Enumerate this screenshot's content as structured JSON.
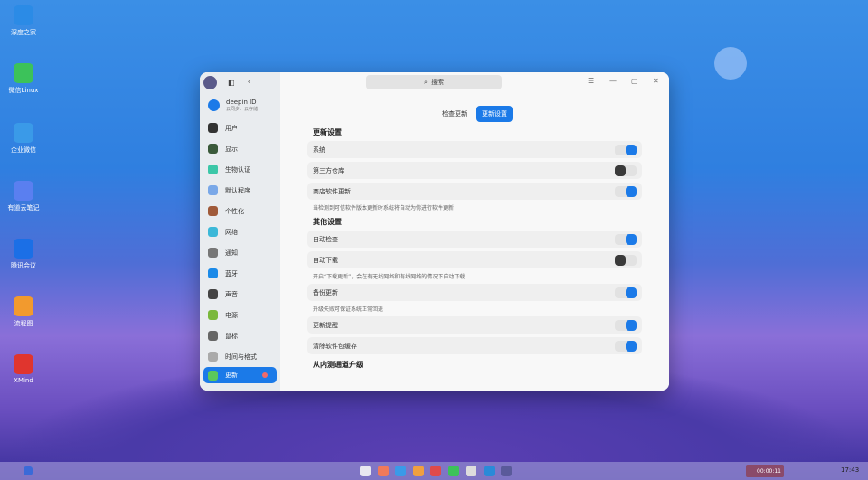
{
  "desktop": {
    "icons": [
      {
        "label": "深度之家",
        "color": "#2b8be6"
      },
      {
        "label": "微信Linux",
        "color": "#3cc25a"
      },
      {
        "label": "企业微信",
        "color": "#3a9ae8"
      },
      {
        "label": "有道云笔记",
        "color": "#5a7ff0"
      },
      {
        "label": "腾讯会议",
        "color": "#1b6fe6"
      },
      {
        "label": "流程图",
        "color": "#f29a2e"
      },
      {
        "label": "XMind",
        "color": "#e0352e"
      }
    ]
  },
  "window": {
    "search_placeholder": "搜索",
    "window_controls": [
      "menu-icon",
      "minimize-icon",
      "maximize-icon",
      "close-icon"
    ]
  },
  "sidebar": {
    "account": {
      "title": "deepin ID",
      "subtitle": "云同步、云存储"
    },
    "items": [
      {
        "label": "用户",
        "color": "#333"
      },
      {
        "label": "显示",
        "color": "#3b5a3b"
      },
      {
        "label": "生物认证",
        "color": "#3cc7a8"
      },
      {
        "label": "默认程序",
        "color": "#7aa8e8"
      },
      {
        "label": "个性化",
        "color": "#a05a3a"
      },
      {
        "label": "网络",
        "color": "#3cb8d8"
      },
      {
        "label": "通知",
        "color": "#777"
      },
      {
        "label": "蓝牙",
        "color": "#1b8ae8"
      },
      {
        "label": "声音",
        "color": "#444"
      },
      {
        "label": "电源",
        "color": "#7ab83c"
      },
      {
        "label": "鼠标",
        "color": "#666"
      },
      {
        "label": "时间与格式",
        "color": "#aaa"
      },
      {
        "label": "更新",
        "color": "#5bc85b",
        "active": true
      }
    ]
  },
  "tabs": [
    {
      "label": "检查更新",
      "active": false
    },
    {
      "label": "更新设置",
      "active": true
    }
  ],
  "sections": [
    {
      "title": "更新设置",
      "rows": [
        {
          "label": "系统",
          "on": true
        },
        {
          "label": "第三方仓库",
          "on": false
        },
        {
          "label": "商店软件更新",
          "on": true,
          "desc": "当检测到可信软件版本更新时系统将自动为你进行软件更新"
        }
      ]
    },
    {
      "title": "其他设置",
      "rows": [
        {
          "label": "自动检查",
          "on": true
        },
        {
          "label": "自动下载",
          "on": false,
          "desc": "开启“下载更新”，会在有无线网络和有线网络的情况下自动下载"
        },
        {
          "label": "备份更新",
          "on": true,
          "desc": "升级失败可保证系统正常回退"
        },
        {
          "label": "更新提醒",
          "on": true
        },
        {
          "label": "清除软件包缓存",
          "on": true
        }
      ]
    },
    {
      "title": "从内测通道升级",
      "rows": []
    }
  ],
  "taskbar": {
    "record_time": "00:00:11",
    "clock": "17:43"
  }
}
